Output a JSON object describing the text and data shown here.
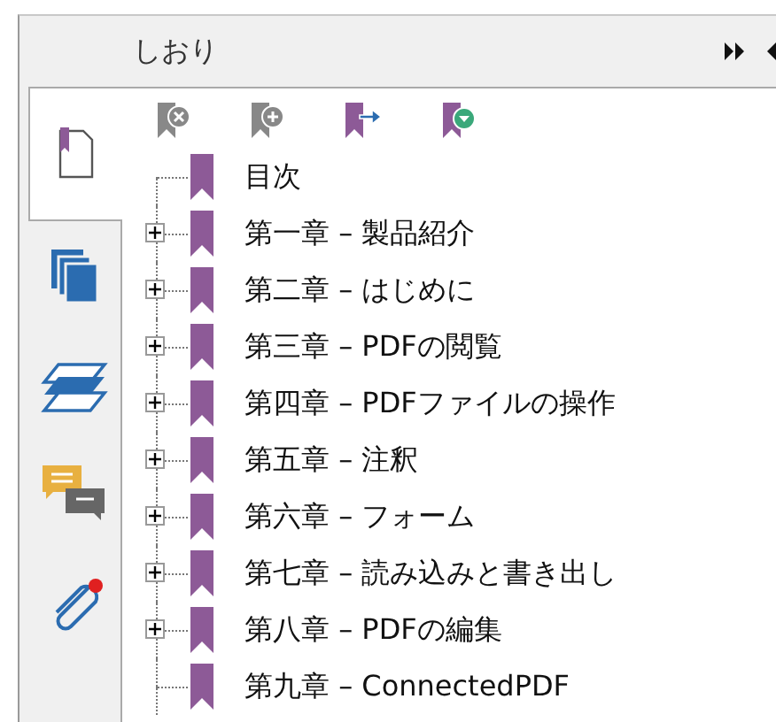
{
  "panel": {
    "title": "しおり"
  },
  "side_tabs": [
    {
      "kind": "bookmarks",
      "selected": true
    },
    {
      "kind": "pages",
      "selected": false
    },
    {
      "kind": "layers",
      "selected": false
    },
    {
      "kind": "comments",
      "selected": false
    },
    {
      "kind": "attachments",
      "selected": false
    }
  ],
  "bookmarks": [
    {
      "label": "目次",
      "kind": "leaf"
    },
    {
      "label": "第一章 – 製品紹介",
      "kind": "collapsed"
    },
    {
      "label": "第二章 – はじめに",
      "kind": "collapsed"
    },
    {
      "label": "第三章 – PDFの閲覧",
      "kind": "collapsed"
    },
    {
      "label": "第四章 – PDFファイルの操作",
      "kind": "collapsed"
    },
    {
      "label": "第五章 – 注釈",
      "kind": "collapsed"
    },
    {
      "label": "第六章 – フォーム",
      "kind": "collapsed"
    },
    {
      "label": "第七章 – 読み込みと書き出し",
      "kind": "collapsed"
    },
    {
      "label": "第八章 – PDFの編集",
      "kind": "collapsed"
    },
    {
      "label": "第九章 – ConnectedPDF",
      "kind": "leaf"
    }
  ]
}
